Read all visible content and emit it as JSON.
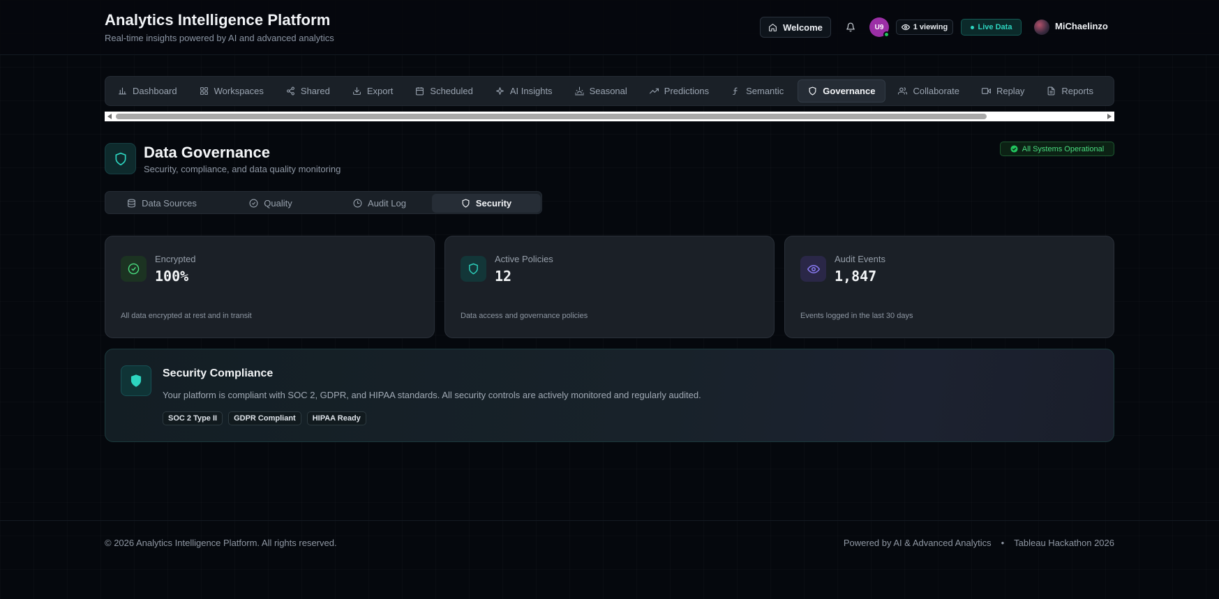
{
  "header": {
    "title": "Analytics Intelligence Platform",
    "subtitle": "Real-time insights powered by AI and advanced analytics",
    "welcome_label": "Welcome",
    "avatar_initials": "U9",
    "viewing_label": "1 viewing",
    "live_label": "Live Data",
    "user_name": "MiChaelinzo"
  },
  "nav": {
    "items": [
      {
        "label": "Dashboard",
        "icon": "bar-chart-icon"
      },
      {
        "label": "Workspaces",
        "icon": "grid-icon"
      },
      {
        "label": "Shared",
        "icon": "share-icon"
      },
      {
        "label": "Export",
        "icon": "download-icon"
      },
      {
        "label": "Scheduled",
        "icon": "calendar-icon"
      },
      {
        "label": "AI Insights",
        "icon": "sparkle-icon"
      },
      {
        "label": "Seasonal",
        "icon": "sun-icon"
      },
      {
        "label": "Predictions",
        "icon": "trend-up-icon"
      },
      {
        "label": "Semantic",
        "icon": "function-icon"
      },
      {
        "label": "Governance",
        "icon": "shield-icon"
      },
      {
        "label": "Collaborate",
        "icon": "users-icon"
      },
      {
        "label": "Replay",
        "icon": "video-icon"
      },
      {
        "label": "Reports",
        "icon": "file-icon"
      }
    ],
    "active": "Governance"
  },
  "page": {
    "title": "Data Governance",
    "subtitle": "Security, compliance, and data quality monitoring",
    "status": "All Systems Operational"
  },
  "subtabs": {
    "items": [
      {
        "label": "Data Sources",
        "icon": "database-icon"
      },
      {
        "label": "Quality",
        "icon": "check-circle-icon"
      },
      {
        "label": "Audit Log",
        "icon": "clock-icon"
      },
      {
        "label": "Security",
        "icon": "shield-icon"
      }
    ],
    "active": "Security"
  },
  "cards": [
    {
      "label": "Encrypted",
      "value": "100%",
      "desc": "All data encrypted at rest and in transit",
      "icon": "check-circle-icon",
      "color": "#4ade80"
    },
    {
      "label": "Active Policies",
      "value": "12",
      "desc": "Data access and governance policies",
      "icon": "shield-icon",
      "color": "#2dd4bf"
    },
    {
      "label": "Audit Events",
      "value": "1,847",
      "desc": "Events logged in the last 30 days",
      "icon": "eye-icon",
      "color": "#8b7cf6"
    }
  ],
  "compliance": {
    "title": "Security Compliance",
    "text": "Your platform is compliant with SOC 2, GDPR, and HIPAA standards. All security controls are actively monitored and regularly audited.",
    "badges": [
      "SOC 2 Type II",
      "GDPR Compliant",
      "HIPAA Ready"
    ]
  },
  "footer": {
    "copyright": "© 2026 Analytics Intelligence Platform. All rights reserved.",
    "powered": "Powered by AI & Advanced Analytics",
    "separator": "•",
    "event": "Tableau Hackathon 2026"
  },
  "colors": {
    "accent": "#2dd4bf",
    "success": "#4ade80",
    "purple": "#8b7cf6",
    "background": "#05080d"
  }
}
